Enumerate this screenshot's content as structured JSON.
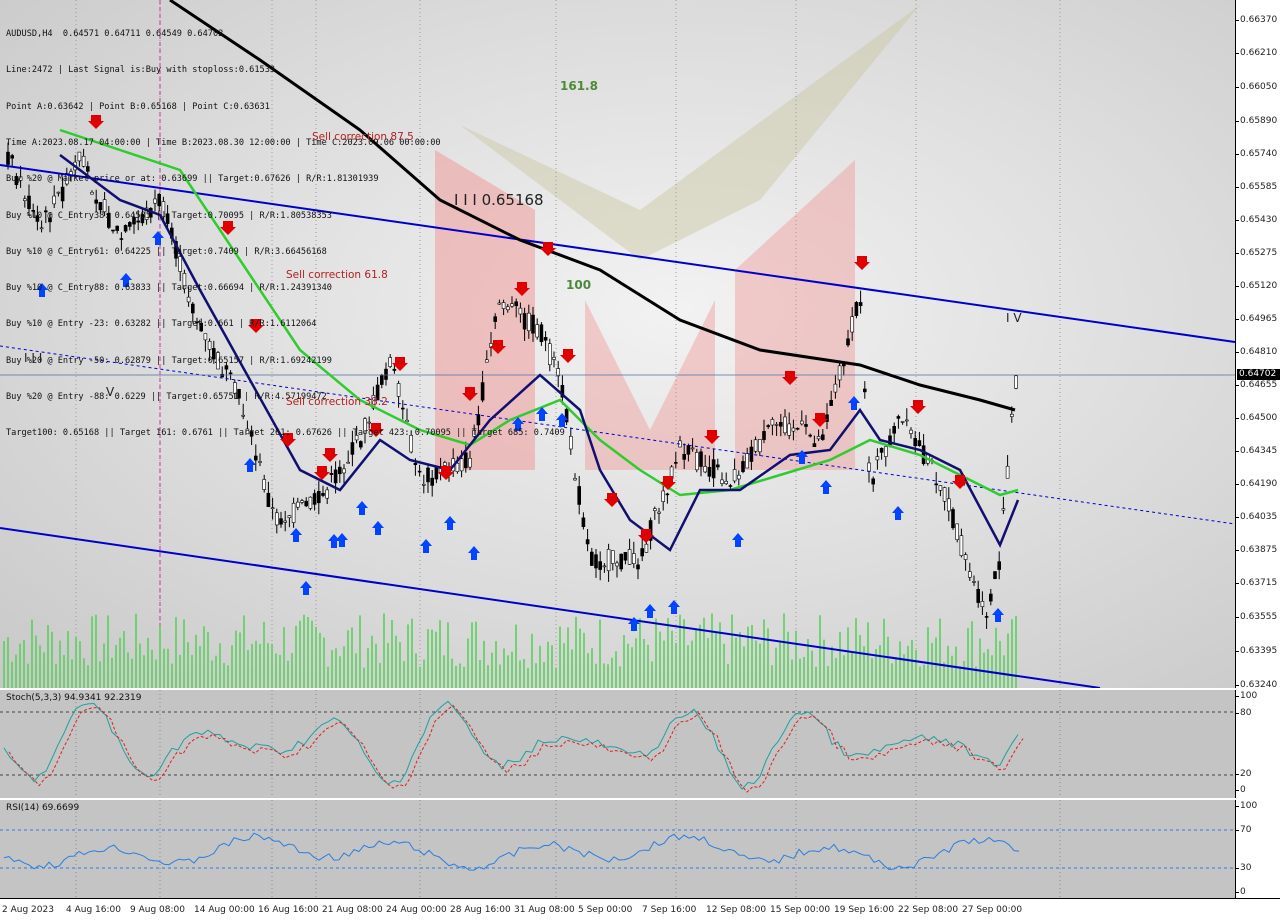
{
  "header": {
    "symbol_line": "AUDUSD,H4  0.64571 0.64711 0.64549 0.64702",
    "lines": [
      "Line:2472 | Last Signal is:Buy with stoploss:0.61533",
      "Point A:0.63642 | Point B:0.65168 | Point C:0.63631",
      "Time A:2023.08.17 04:00:00 | Time B:2023.08.30 12:00:00 | Time C:2023.09.06 00:00:00",
      "Buy %20 @ Market price or at: 0.63699 || Target:0.67626 | R/R:1.81301939",
      "Buy %10 @ C_Entry38: 0.64585 || Target:0.70095 | R/R:1.80538353",
      "Buy %10 @ C_Entry61: 0.64225 || Target:0.7409 | R/R:3.66456168",
      "Buy %10 @ C_Entry88: 0.63833 || Target:0.66694 | R/R:1.24391340",
      "Buy %10 @ Entry -23: 0.63282 || Target:0.661 | R/R:1.6112064",
      "Buy %20 @ Entry -50: 0.62879 || Target:0.65157 | R/R:1.69242199",
      "Buy %20 @ Entry -88: 0.6229 || Target:0.65751 | R/R:4.57199472",
      "Target100: 0.65168 || Target 161: 0.6761 || Target 261: 0.67626 || Target 423: 0.70095 || Target 685: 0.7409"
    ]
  },
  "annotations": {
    "sell_618": "Sell correction 61.8",
    "sell_875": "Sell correction 87.5",
    "sell_382": "Sell correction 38.2",
    "lvl_1618": "161.8",
    "lvl_100": "100",
    "point_b_price": "I I I 0.65168",
    "wave_iii": "I I I",
    "wave_v_top": "I V",
    "wave_v_low": "V"
  },
  "price_axis": {
    "ticks": [
      "0.66370",
      "0.66210",
      "0.66050",
      "0.65890",
      "0.65740",
      "0.65585",
      "0.65430",
      "0.65275",
      "0.65120",
      "0.64965",
      "0.64810",
      "0.64655",
      "0.64500",
      "0.64345",
      "0.64190",
      "0.64035",
      "0.63875",
      "0.63715",
      "0.63555",
      "0.63395",
      "0.63240"
    ],
    "current_price": "0.64702"
  },
  "stoch": {
    "title": "Stoch(5,3,3) 94.9341 92.2319",
    "ticks": [
      "100",
      "80",
      "20",
      "0"
    ]
  },
  "rsi": {
    "title": "RSI(14) 69.6699",
    "ticks": [
      "100",
      "70",
      "30",
      "0"
    ]
  },
  "time_axis": {
    "labels": [
      "2 Aug 2023",
      "4 Aug 16:00",
      "9 Aug 08:00",
      "14 Aug 00:00",
      "16 Aug 16:00",
      "21 Aug 08:00",
      "24 Aug 00:00",
      "28 Aug 16:00",
      "31 Aug 08:00",
      "5 Sep 00:00",
      "7 Sep 16:00",
      "12 Sep 08:00",
      "15 Sep 00:00",
      "19 Sep 16:00",
      "22 Sep 08:00",
      "27 Sep 00:00"
    ]
  },
  "colors": {
    "bull_candle": "#ffffff",
    "bear_candle": "#000000",
    "ma_fast": "#101070",
    "ma_mid": "#2ecc2e",
    "ma_slow": "#000000",
    "channel": "#0000cc",
    "sell_arrow": "#e00000",
    "buy_arrow": "#0044ff",
    "stoch_main": "#20a0a0",
    "stoch_signal": "#e02020",
    "rsi_line": "#2a7ee0"
  }
}
